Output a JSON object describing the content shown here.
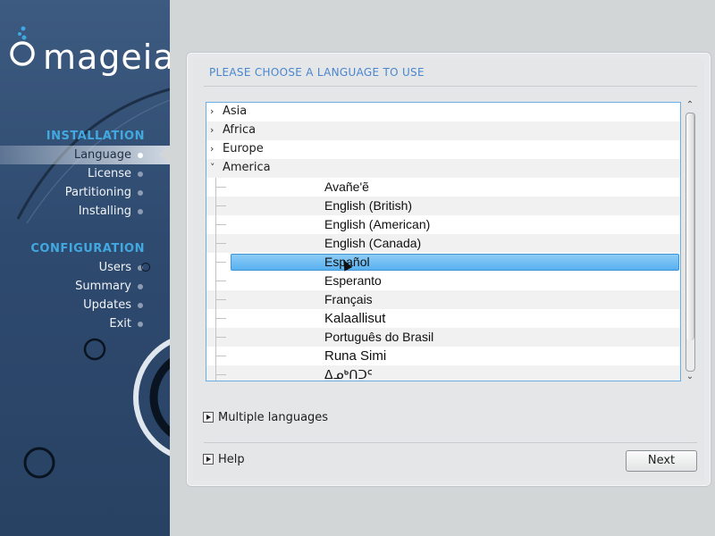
{
  "sidebar": {
    "logo_text": "mageia",
    "installation_title": "INSTALLATION",
    "installation_items": [
      {
        "label": "Language",
        "active": true
      },
      {
        "label": "License"
      },
      {
        "label": "Partitioning"
      },
      {
        "label": "Installing"
      }
    ],
    "configuration_title": "CONFIGURATION",
    "configuration_items": [
      {
        "label": "Users"
      },
      {
        "label": "Summary"
      },
      {
        "label": "Updates"
      },
      {
        "label": "Exit"
      }
    ]
  },
  "panel": {
    "title": "PLEASE CHOOSE A LANGUAGE TO USE",
    "tree": {
      "regions": [
        {
          "label": "Asia",
          "expanded": false
        },
        {
          "label": "Africa",
          "expanded": false
        },
        {
          "label": "Europe",
          "expanded": false
        },
        {
          "label": "America",
          "expanded": true
        }
      ],
      "languages": [
        "Avañe'ẽ",
        "English (British)",
        "English (American)",
        "English (Canada)",
        "Español",
        "Esperanto",
        "Français",
        "Kalaallisut",
        "Português do Brasil",
        "Runa Simi",
        "ᐃᓄᒃᑎᑐᑦ"
      ],
      "selected_language": "Español",
      "collapsed_glyph": "›",
      "expanded_glyph": "˅"
    },
    "multiple_languages_label": "Multiple languages",
    "help_label": "Help",
    "next_label": "Next"
  },
  "colors": {
    "sidebar_bg": "#2e4a6f",
    "section_title": "#42a9e0",
    "panel_title": "#4a86cf",
    "selection": "#58b0ef"
  }
}
